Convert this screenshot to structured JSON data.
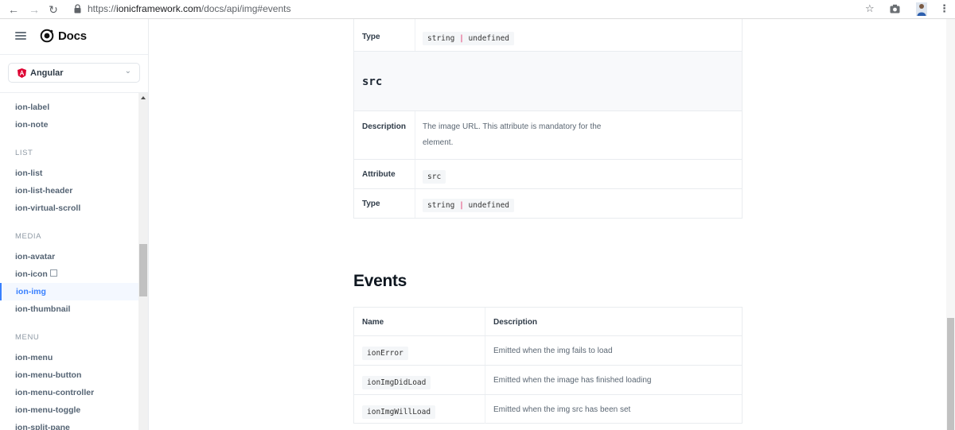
{
  "browser": {
    "url_prefix": "https://",
    "url_host": "ionicframework.com",
    "url_path": "/docs/api/img#events"
  },
  "sidebar": {
    "title": "Docs",
    "framework": "Angular",
    "items": {
      "ion_label": "ion-label",
      "ion_note": "ion-note",
      "cat_list": "LIST",
      "ion_list": "ion-list",
      "ion_list_header": "ion-list-header",
      "ion_virtual_scroll": "ion-virtual-scroll",
      "cat_media": "MEDIA",
      "ion_avatar": "ion-avatar",
      "ion_icon": "ion-icon",
      "ion_img": "ion-img",
      "ion_thumbnail": "ion-thumbnail",
      "cat_menu": "MENU",
      "ion_menu": "ion-menu",
      "ion_menu_button": "ion-menu-button",
      "ion_menu_controller": "ion-menu-controller",
      "ion_menu_toggle": "ion-menu-toggle",
      "ion_split_pane": "ion-split-pane"
    }
  },
  "properties": {
    "prev_type_label": "Type",
    "prev_type_a": "string",
    "prev_type_sep": "|",
    "prev_type_b": "undefined",
    "src_title": "src",
    "description_label": "Description",
    "src_description": "The image URL. This attribute is mandatory for the element.",
    "attribute_label": "Attribute",
    "src_attribute": "src",
    "type_label": "Type",
    "src_type_a": "string",
    "src_type_sep": "|",
    "src_type_b": "undefined"
  },
  "events": {
    "heading": "Events",
    "col_name": "Name",
    "col_description": "Description",
    "rows": [
      {
        "name": "ionError",
        "description": "Emitted when the img fails to load"
      },
      {
        "name": "ionImgDidLoad",
        "description": "Emitted when the image has finished loading"
      },
      {
        "name": "ionImgWillLoad",
        "description": "Emitted when the img src has been set"
      }
    ]
  },
  "colors": {
    "accent": "#3880ff",
    "angular_red": "#dd0031"
  }
}
